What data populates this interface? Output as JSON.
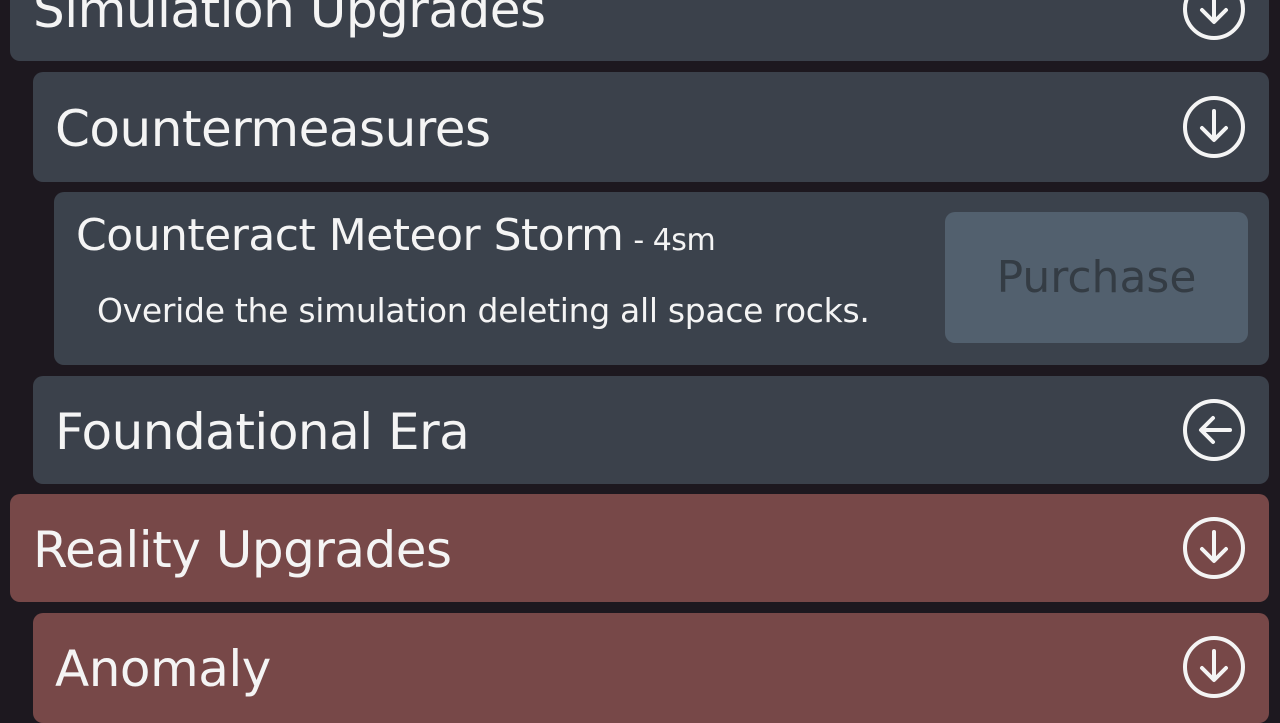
{
  "sections": {
    "simulation_upgrades": {
      "title": "Simulation Upgrades",
      "icon": "arrow-down-circle-icon"
    },
    "countermeasures": {
      "title": "Countermeasures",
      "icon": "arrow-down-circle-icon"
    },
    "upgrade_item": {
      "name": "Counteract Meteor Storm",
      "cost": "- 4sm",
      "description": "Overide the simulation deleting all space rocks.",
      "purchase_label": "Purchase"
    },
    "foundational_era": {
      "title": "Foundational Era",
      "icon": "arrow-left-circle-icon"
    },
    "reality_upgrades": {
      "title": "Reality Upgrades",
      "icon": "arrow-down-circle-icon"
    },
    "anomaly": {
      "title": "Anomaly",
      "icon": "arrow-down-circle-icon"
    }
  },
  "colors": {
    "background": "#1d181f",
    "slate_panel": "#3b414b",
    "rose_panel": "#774848",
    "purchase_button": "#52606e",
    "purchase_text": "#343c44",
    "text": "#f4f4f4"
  }
}
